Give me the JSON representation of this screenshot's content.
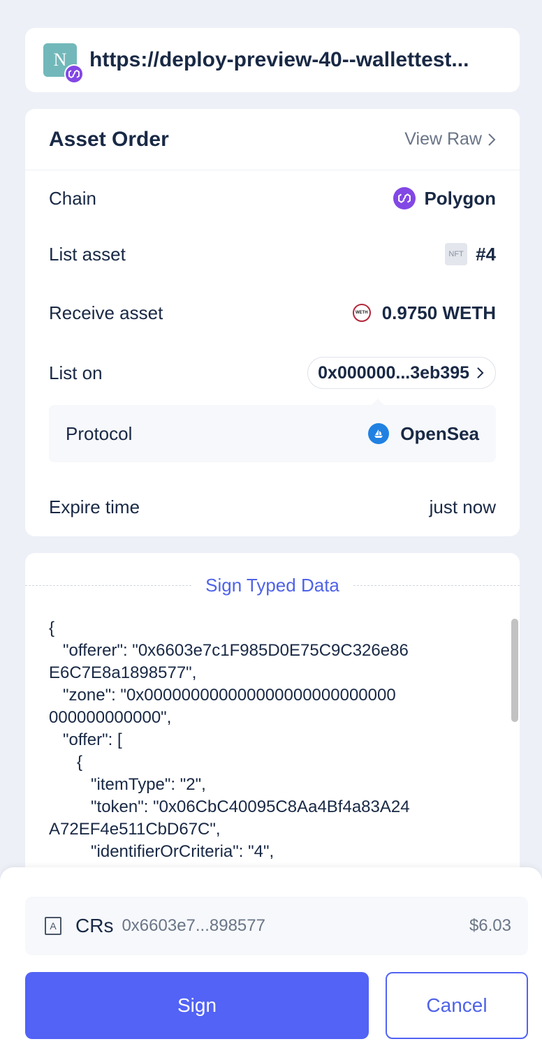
{
  "origin": {
    "avatar_letter": "N",
    "url": "https://deploy-preview-40--wallettest..."
  },
  "order": {
    "title": "Asset Order",
    "view_raw": "View Raw",
    "rows": {
      "chain": {
        "label": "Chain",
        "value": "Polygon"
      },
      "list_asset": {
        "label": "List asset",
        "badge": "NFT",
        "value": "#4"
      },
      "receive_asset": {
        "label": "Receive asset",
        "icon_text": "WETH",
        "value": "0.9750 WETH"
      },
      "list_on": {
        "label": "List on",
        "value": "0x000000...3eb395"
      },
      "protocol": {
        "label": "Protocol",
        "value": "OpenSea"
      },
      "expire_time": {
        "label": "Expire time",
        "value": "just now"
      }
    }
  },
  "typed_data": {
    "title": "Sign Typed Data",
    "lines": [
      "{",
      "   \"offerer\": \"0x6603e7c1F985D0E75C9C326e86",
      "E6C7E8a1898577\",",
      "   \"zone\": \"0x000000000000000000000000000",
      "000000000000\",",
      "   \"offer\": [",
      "      {",
      "         \"itemType\": \"2\",",
      "         \"token\": \"0x06CbC40095C8Aa4Bf4a83A24",
      "A72EF4e511CbD67C\",",
      "         \"identifierOrCriteria\": \"4\","
    ]
  },
  "account": {
    "icon_letter": "A",
    "name": "CRs",
    "address": "0x6603e7...898577",
    "balance": "$6.03"
  },
  "actions": {
    "sign": "Sign",
    "cancel": "Cancel"
  },
  "colors": {
    "primary": "#5263f5",
    "polygon": "#8247e5",
    "opensea": "#2081e2",
    "page_bg": "#eef0f8"
  }
}
